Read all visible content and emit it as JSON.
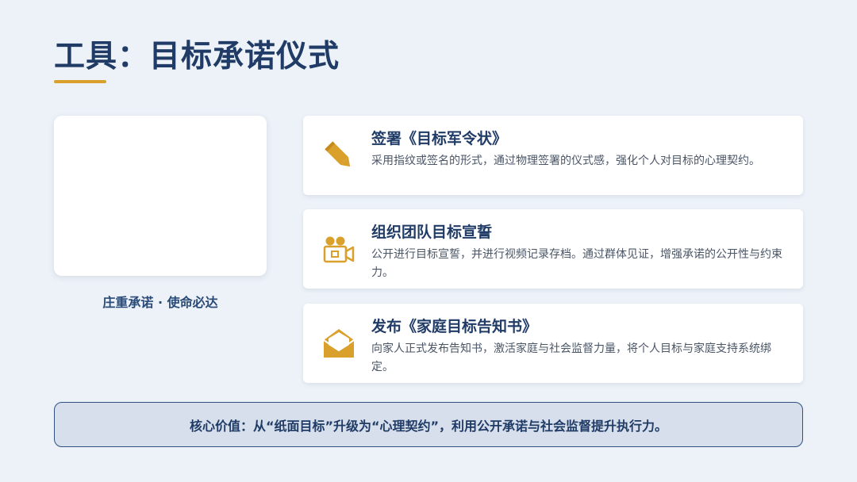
{
  "page": {
    "title": "工具：目标承诺仪式"
  },
  "left_panel": {
    "caption": "庄重承诺 · 使命必达"
  },
  "cards": [
    {
      "icon": "pencil-icon",
      "title": "签署《目标军令状》",
      "description": "采用指纹或签名的形式，通过物理签署的仪式感，强化个人对目标的心理契约。"
    },
    {
      "icon": "video-camera-icon",
      "title": "组织团队目标宣誓",
      "description": "公开进行目标宣誓，并进行视频记录存档。通过群体见证，增强承诺的公开性与约束力。"
    },
    {
      "icon": "envelope-icon",
      "title": "发布《家庭目标告知书》",
      "description": "向家人正式发布告知书，激活家庭与社会监督力量，将个人目标与家庭支持系统绑定。"
    }
  ],
  "banner": {
    "text": "核心价值：从“纸面目标”升级为“心理契约”，利用公开承诺与社会监督提升执行力。"
  },
  "colors": {
    "accent": "#d9a02c",
    "primary": "#1f3b66",
    "background": "#edf2f8"
  }
}
